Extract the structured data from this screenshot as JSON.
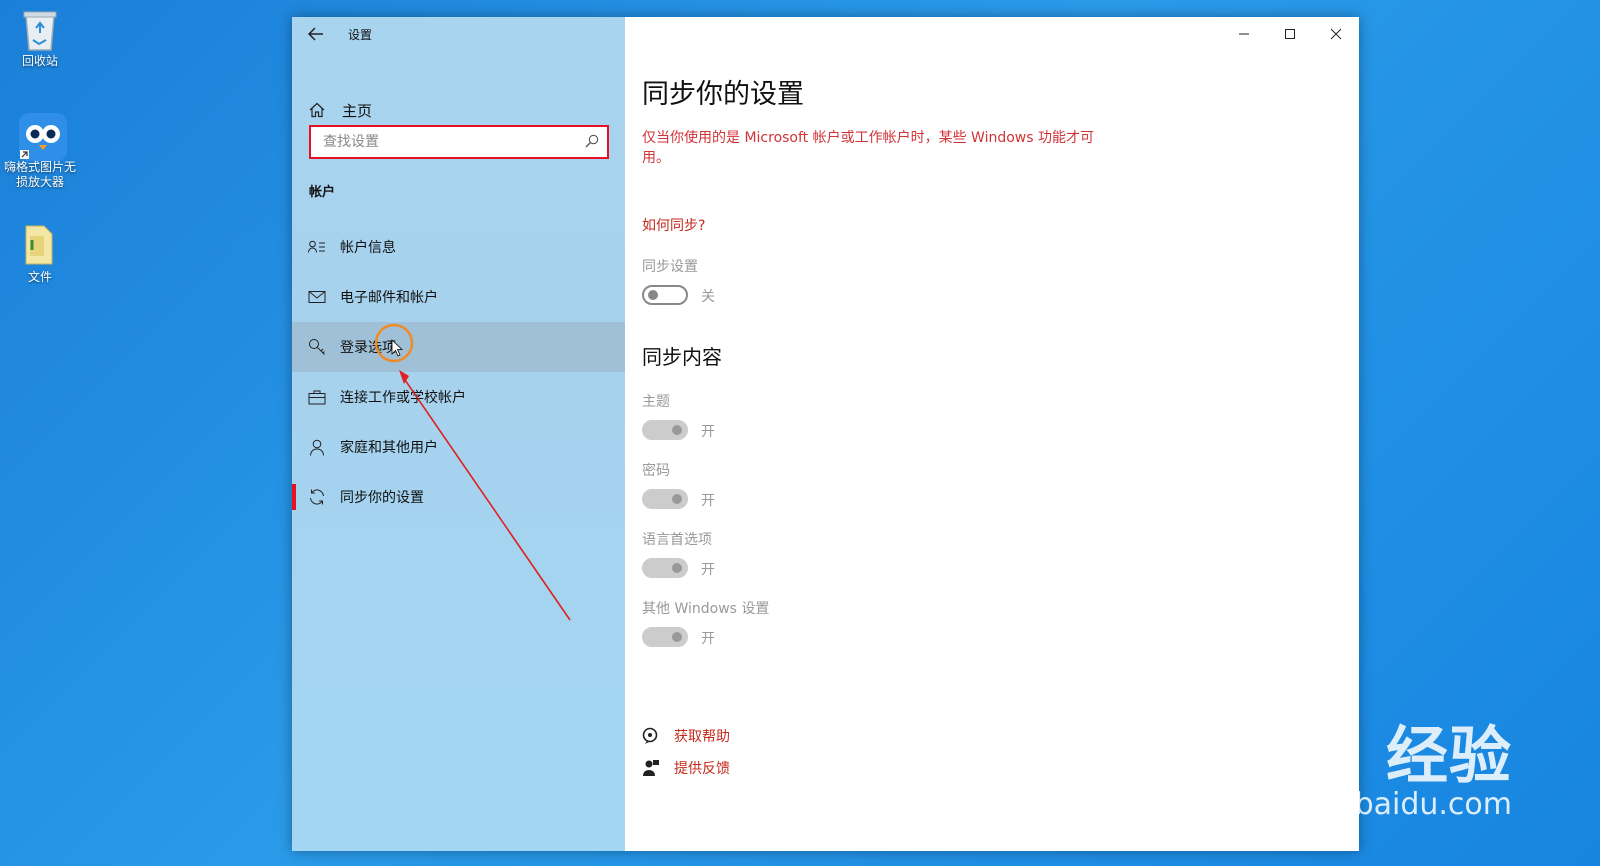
{
  "desktop": {
    "icons": [
      {
        "label": "回收站"
      },
      {
        "label_line1": "嗨格式图片无",
        "label_line2": "损放大器"
      },
      {
        "label": "文件"
      }
    ]
  },
  "window": {
    "title": "设置",
    "home_label": "主页",
    "search_placeholder": "查找设置",
    "section": "帐户",
    "nav_items": [
      {
        "label": "帐户信息",
        "icon": "account-info-icon"
      },
      {
        "label": "电子邮件和帐户",
        "icon": "mail-icon"
      },
      {
        "label": "登录选项",
        "icon": "key-icon"
      },
      {
        "label": "连接工作或学校帐户",
        "icon": "briefcase-icon"
      },
      {
        "label": "家庭和其他用户",
        "icon": "person-icon"
      },
      {
        "label": "同步你的设置",
        "icon": "sync-icon"
      }
    ]
  },
  "content": {
    "page_title": "同步你的设置",
    "warning": "仅当你使用的是 Microsoft 帐户或工作帐户时，某些 Windows 功能才可用。",
    "how_sync_link": "如何同步?",
    "sync_setting_label": "同步设置",
    "sync_setting_state": "关",
    "sync_content_title": "同步内容",
    "items": [
      {
        "label": "主题",
        "state": "开"
      },
      {
        "label": "密码",
        "state": "开"
      },
      {
        "label": "语言首选项",
        "state": "开"
      },
      {
        "label": "其他 Windows 设置",
        "state": "开"
      }
    ],
    "help_label": "获取帮助",
    "feedback_label": "提供反馈"
  },
  "watermark": {
    "brand": "Bai du 经验",
    "url": "jingyan.baidu.com"
  },
  "colors": {
    "accent_red": "#e81123",
    "link_red": "#c42b1c",
    "sidebar_blue": "#a9d4ef",
    "desktop_blue": "#1a7fd8"
  }
}
